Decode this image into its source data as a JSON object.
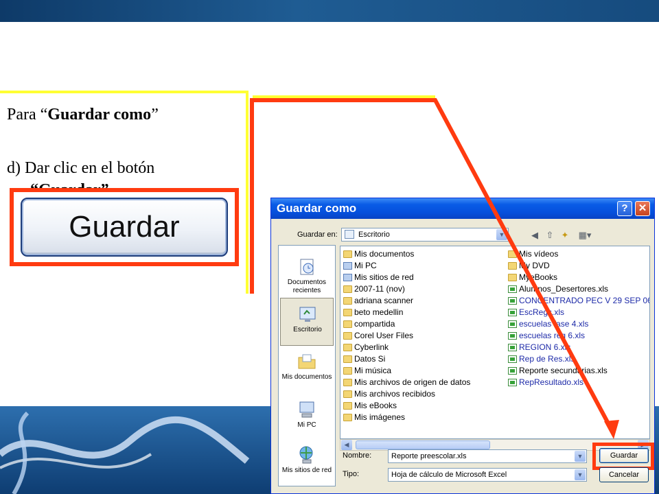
{
  "slide": {
    "instruction_line1_prefix": "Para “",
    "instruction_line1_bold": "Guardar como",
    "instruction_line1_suffix": "”",
    "instruction_line2": "d) Dar clic en el botón",
    "instruction_line3": "“Guardar”",
    "big_button_label": "Guardar"
  },
  "dialog": {
    "title": "Guardar como",
    "help_glyph": "?",
    "close_glyph": "✕",
    "save_in_label": "Guardar en:",
    "save_in_value": "Escritorio",
    "places": [
      {
        "label": "Documentos recientes"
      },
      {
        "label": "Escritorio"
      },
      {
        "label": "Mis documentos"
      },
      {
        "label": "Mi PC"
      },
      {
        "label": "Mis sitios de red"
      }
    ],
    "files_col1": [
      {
        "name": "Mis documentos",
        "icon": "folder",
        "blue": false
      },
      {
        "name": "Mi PC",
        "icon": "sys",
        "blue": false
      },
      {
        "name": "Mis sitios de red",
        "icon": "sys",
        "blue": false
      },
      {
        "name": "2007-11 (nov)",
        "icon": "folder",
        "blue": false
      },
      {
        "name": "adriana scanner",
        "icon": "folder",
        "blue": false
      },
      {
        "name": "beto medellin",
        "icon": "folder",
        "blue": false
      },
      {
        "name": "compartida",
        "icon": "folder",
        "blue": false
      },
      {
        "name": "Corel User Files",
        "icon": "folder",
        "blue": false
      },
      {
        "name": "Cyberlink",
        "icon": "folder",
        "blue": false
      },
      {
        "name": "Datos Si",
        "icon": "folder",
        "blue": false
      },
      {
        "name": "Mi música",
        "icon": "folder",
        "blue": false
      },
      {
        "name": "Mis archivos de origen de datos",
        "icon": "folder",
        "blue": false
      },
      {
        "name": "Mis archivos recibidos",
        "icon": "folder",
        "blue": false
      },
      {
        "name": "Mis eBooks",
        "icon": "folder",
        "blue": false
      },
      {
        "name": "Mis imágenes",
        "icon": "folder",
        "blue": false
      }
    ],
    "files_col2": [
      {
        "name": "Mis vídeos",
        "icon": "folder",
        "blue": false
      },
      {
        "name": "My DVD",
        "icon": "folder",
        "blue": false
      },
      {
        "name": "MyeBooks",
        "icon": "folder",
        "blue": false
      },
      {
        "name": "Alumnos_Desertores.xls",
        "icon": "xls",
        "blue": false
      },
      {
        "name": "CONCENTRADO PEC V  29 SEP 06",
        "icon": "xls",
        "blue": true
      },
      {
        "name": "EscRegs.xls",
        "icon": "xls",
        "blue": true
      },
      {
        "name": "escuelas fase 4.xls",
        "icon": "xls",
        "blue": true
      },
      {
        "name": "escuelas reg 6.xls",
        "icon": "xls",
        "blue": true
      },
      {
        "name": "REGION 6.xls",
        "icon": "xls",
        "blue": true
      },
      {
        "name": "Rep de Res.xls",
        "icon": "xls",
        "blue": true
      },
      {
        "name": "Reporte secundarias.xls",
        "icon": "xls",
        "blue": false
      },
      {
        "name": "RepResultado.xls",
        "icon": "xls",
        "blue": true
      }
    ],
    "name_label": "Nombre:",
    "name_value": "Reporte preescolar.xls",
    "type_label": "Tipo:",
    "type_value": "Hoja de cálculo de Microsoft Excel",
    "save_button": "Guardar",
    "cancel_button": "Cancelar"
  },
  "colors": {
    "highlight_red": "#ff3b10",
    "highlight_yellow": "#ffff33",
    "xp_title_blue": "#0550dc"
  }
}
